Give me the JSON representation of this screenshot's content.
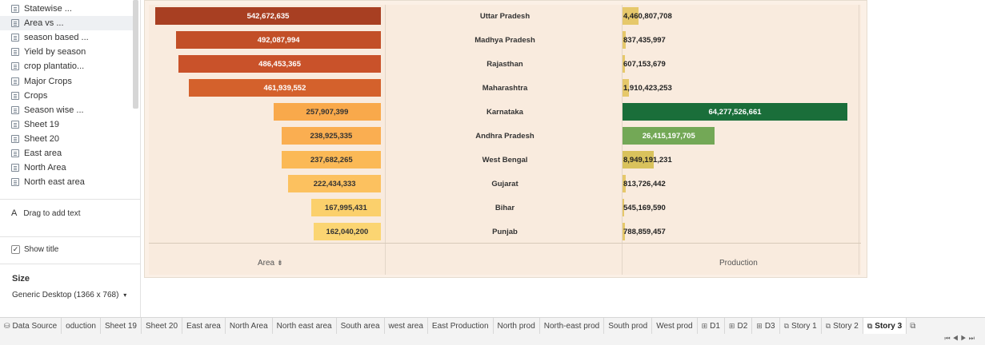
{
  "sidebar": {
    "sheets": [
      {
        "label": "Statewise ...",
        "icon": "dashboard-sheet-icon"
      },
      {
        "label": "Area vs ...",
        "icon": "dashboard-sheet-icon",
        "selected": true
      },
      {
        "label": "season based ...",
        "icon": "worksheet-icon"
      },
      {
        "label": "Yield by season",
        "icon": "worksheet-icon"
      },
      {
        "label": "crop plantatio...",
        "icon": "worksheet-icon"
      },
      {
        "label": "Major Crops",
        "icon": "worksheet-icon"
      },
      {
        "label": "Crops",
        "icon": "worksheet-icon"
      },
      {
        "label": "Season wise ...",
        "icon": "worksheet-icon"
      },
      {
        "label": "Sheet 19",
        "icon": "worksheet-icon"
      },
      {
        "label": "Sheet 20",
        "icon": "worksheet-icon"
      },
      {
        "label": "East area",
        "icon": "worksheet-icon"
      },
      {
        "label": "North Area",
        "icon": "worksheet-icon"
      },
      {
        "label": "North east area",
        "icon": "worksheet-icon"
      }
    ],
    "drag_text": "Drag to add text",
    "show_title": "Show title",
    "size_heading": "Size",
    "size_value": "Generic Desktop (1366 x 768)"
  },
  "chart_data": {
    "type": "bar",
    "categories": [
      "Uttar Pradesh",
      "Madhya Pradesh",
      "Rajasthan",
      "Maharashtra",
      "Karnataka",
      "Andhra Pradesh",
      "West Bengal",
      "Gujarat",
      "Bihar",
      "Punjab"
    ],
    "series": [
      {
        "name": "Area",
        "values": [
          542672635,
          492087994,
          486453365,
          461939552,
          257907399,
          238925335,
          237682265,
          222434333,
          167995431,
          162040200
        ],
        "labels": [
          "542,672,635",
          "492,087,994",
          "486,453,365",
          "461,939,552",
          "257,907,399",
          "238,925,335",
          "237,682,265",
          "222,434,333",
          "167,995,431",
          "162,040,200"
        ]
      },
      {
        "name": "Production",
        "values": [
          4460807708,
          837435997,
          607153679,
          1910423253,
          64277526661,
          26415197705,
          8949191231,
          813726442,
          545169590,
          788859457
        ],
        "labels": [
          "4,460,807,708",
          "837,435,997",
          "607,153,679",
          "1,910,423,253",
          "64,277,526,661",
          "26,415,197,705",
          "8,949,191,231",
          "813,726,442",
          "545,169,590",
          "788,859,457"
        ]
      }
    ],
    "area_colors": [
      "#a83f22",
      "#c24f27",
      "#c9522a",
      "#d4612c",
      "#f9a94b",
      "#faae51",
      "#fbb956",
      "#fcc15f",
      "#fbd06c",
      "#fbd572"
    ],
    "production_colors": [
      "#e6c86a",
      "#e6c86a",
      "#e6c86a",
      "#e6c86a",
      "#1a6e3a",
      "#73a856",
      "#d9c25c",
      "#e6c86a",
      "#e6c86a",
      "#e6c86a"
    ],
    "xlabel_area": "Area",
    "xlabel_production": "Production"
  },
  "tabs": [
    {
      "label": "Data Source",
      "icon": "database-icon"
    },
    {
      "label": "oduction"
    },
    {
      "label": "Sheet 19"
    },
    {
      "label": "Sheet 20"
    },
    {
      "label": "East area"
    },
    {
      "label": "North Area"
    },
    {
      "label": "North east area"
    },
    {
      "label": "South area"
    },
    {
      "label": "west area"
    },
    {
      "label": "East Production"
    },
    {
      "label": "North prod"
    },
    {
      "label": "North-east prod"
    },
    {
      "label": "South prod"
    },
    {
      "label": "West prod"
    },
    {
      "label": "D1",
      "icon": "dashboard-tab-icon"
    },
    {
      "label": "D2",
      "icon": "dashboard-tab-icon"
    },
    {
      "label": "D3",
      "icon": "dashboard-tab-icon"
    },
    {
      "label": "Story 1",
      "icon": "story-tab-icon"
    },
    {
      "label": "Story 2",
      "icon": "story-tab-icon"
    },
    {
      "label": "Story 3",
      "icon": "story-tab-icon",
      "active": true
    }
  ]
}
